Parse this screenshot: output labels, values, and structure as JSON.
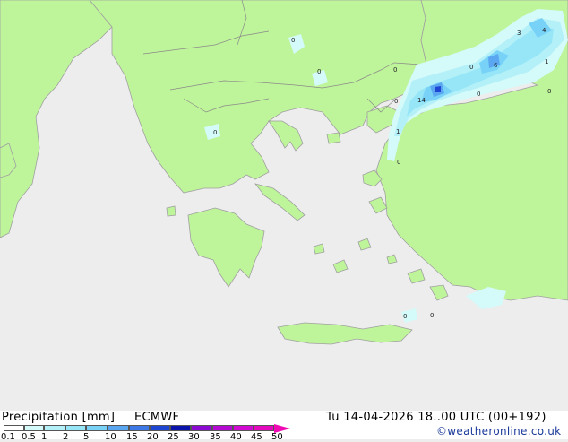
{
  "map": {
    "colors": {
      "sea": "#ededed",
      "land": "#bff59a",
      "coast": "#a0a0a0",
      "border": "#8a8a8a"
    },
    "precip_labels": [
      "0",
      "0",
      "0",
      "0",
      "14",
      "0",
      "1",
      "0",
      "0",
      "3",
      "4",
      "0",
      "6",
      "1",
      "0",
      "0",
      "0"
    ]
  },
  "footer": {
    "title": "Precipitation [mm]",
    "model": "ECMWF",
    "datetime": "Tu 14-04-2026 18..00 UTC (00+192)",
    "credit": "©weatheronline.co.uk"
  },
  "legend": {
    "ticks": [
      "0.1",
      "0.5",
      "1",
      "2",
      "5",
      "10",
      "15",
      "20",
      "25",
      "30",
      "35",
      "40",
      "45",
      "50"
    ],
    "colors": [
      "#ffffff",
      "#d4fafa",
      "#b4f0f8",
      "#96e6f8",
      "#78d2f8",
      "#5aa6f0",
      "#3c78e6",
      "#1e46d2",
      "#0a14aa",
      "#8c0ad2",
      "#b40ad2",
      "#d20ad2",
      "#e60abe",
      "#f00ab4"
    ]
  }
}
